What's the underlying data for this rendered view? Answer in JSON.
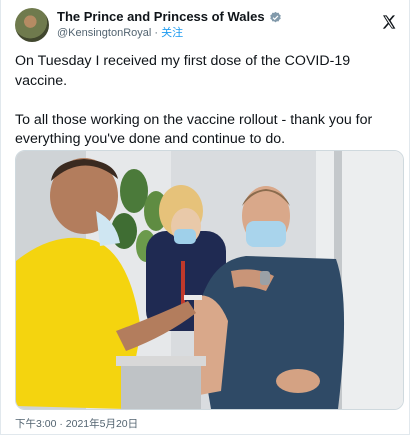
{
  "account": {
    "display_name": "The Prince and Princess of Wales",
    "handle": "@KensingtonRoyal",
    "separator": "·",
    "follow_label": "关注"
  },
  "post": {
    "text": "On Tuesday I received my first dose of the COVID-19 vaccine.\n\nTo all those working on the vaccine rollout - thank you for everything you've done and continue to do.",
    "timestamp": "下午3:00 · 2021年5月20日"
  },
  "icons": {
    "verified": "verified-badge-icon",
    "platform": "x-logo-icon"
  },
  "colors": {
    "accent": "#1d9bf0",
    "text": "#0f1419",
    "secondary": "#536471"
  }
}
